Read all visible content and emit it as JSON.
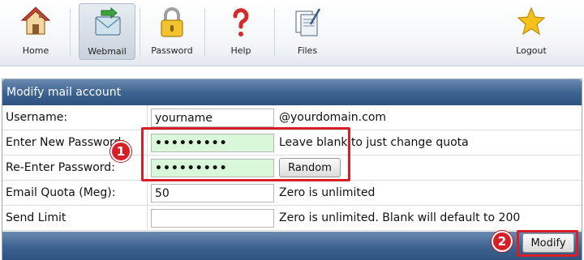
{
  "toolbar": {
    "items": [
      {
        "label": "Home",
        "icon": "house-icon"
      },
      {
        "label": "Webmail",
        "icon": "mail-envelope-icon",
        "active": true
      },
      {
        "label": "Password",
        "icon": "padlock-icon"
      },
      {
        "label": "Help",
        "icon": "question-mark-icon"
      },
      {
        "label": "Files",
        "icon": "files-documents-icon"
      },
      {
        "label": "Logout",
        "icon": "star-icon"
      }
    ]
  },
  "panel": {
    "title": "Modify mail account",
    "rows": {
      "username": {
        "label": "Username:",
        "value": "yourname",
        "suffix": "@yourdomain.com"
      },
      "new_password": {
        "label": "Enter New Password:",
        "value": "•••••••••",
        "hint": "Leave blank to just change quota"
      },
      "re_password": {
        "label": "Re-Enter Password:",
        "value": "•••••••••",
        "button": "Random"
      },
      "quota": {
        "label": "Email Quota (Meg):",
        "value": "50",
        "hint": "Zero is unlimited"
      },
      "send_limit": {
        "label": "Send Limit",
        "value": "",
        "hint": "Zero is unlimited. Blank will default to 200"
      }
    },
    "submit_label": "Modify"
  },
  "annotations": {
    "badge_1": "1",
    "badge_2": "2",
    "highlight_color": "#d61f26"
  },
  "colors": {
    "header_blue": "#3e6492",
    "password_field_bg": "#d9f7d9"
  }
}
